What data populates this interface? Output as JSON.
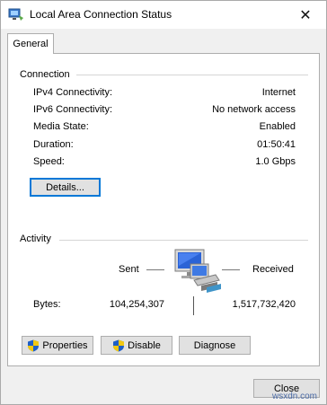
{
  "window": {
    "title": "Local Area Connection Status",
    "close_glyph": "✕"
  },
  "tabs": [
    {
      "label": "General"
    }
  ],
  "connection": {
    "heading": "Connection",
    "rows": [
      {
        "label": "IPv4 Connectivity:",
        "value": "Internet"
      },
      {
        "label": "IPv6 Connectivity:",
        "value": "No network access"
      },
      {
        "label": "Media State:",
        "value": "Enabled"
      },
      {
        "label": "Duration:",
        "value": "01:50:41"
      },
      {
        "label": "Speed:",
        "value": "1.0 Gbps"
      }
    ],
    "details_button": "Details..."
  },
  "activity": {
    "heading": "Activity",
    "sent_label": "Sent",
    "received_label": "Received",
    "bytes_label": "Bytes:",
    "bytes_sent": "104,254,307",
    "bytes_received": "1,517,732,420",
    "network_icon": "network-computers-icon"
  },
  "buttons": {
    "properties": "Properties",
    "disable": "Disable",
    "diagnose": "Diagnose",
    "close": "Close"
  },
  "watermark": "wsxdn.com",
  "colors": {
    "shield_blue": "#1e5fc8",
    "shield_yellow": "#f2c811",
    "focus_blue": "#0078d7"
  }
}
